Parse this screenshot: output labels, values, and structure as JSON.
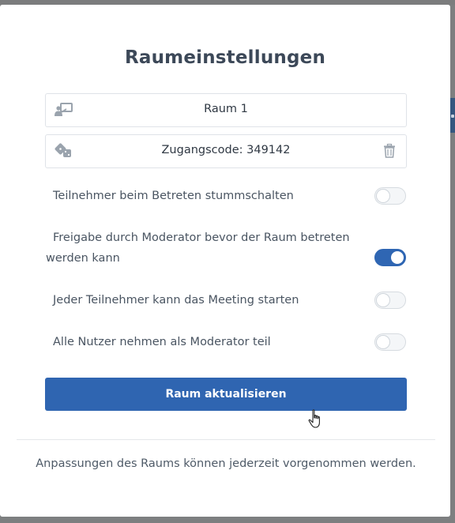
{
  "dialog": {
    "title": "Raumeinstellungen",
    "room_name_value": "Raum 1",
    "access_code_text": "Zugangscode: 349142",
    "icons": {
      "room_name": "presenter-board-icon",
      "access_code": "dice-icon",
      "delete_access_code": "trash-icon"
    },
    "toggles": [
      {
        "label": "Teilnehmer beim Betreten stummschalten",
        "checked": false
      },
      {
        "label": "Freigabe durch Moderator bevor der Raum betreten werden kann",
        "checked": true
      },
      {
        "label": "Jeder Teilnehmer kann das Meeting starten",
        "checked": false
      },
      {
        "label": "Alle Nutzer nehmen als Moderator teil",
        "checked": false
      }
    ],
    "submit_label": "Raum aktualisieren",
    "footer_note": "Anpassungen des Raums können jederzeit vorgenommen werden."
  },
  "colors": {
    "accent": "#2f65b1",
    "backdrop": "#7d7f80",
    "title": "#3c4858"
  }
}
